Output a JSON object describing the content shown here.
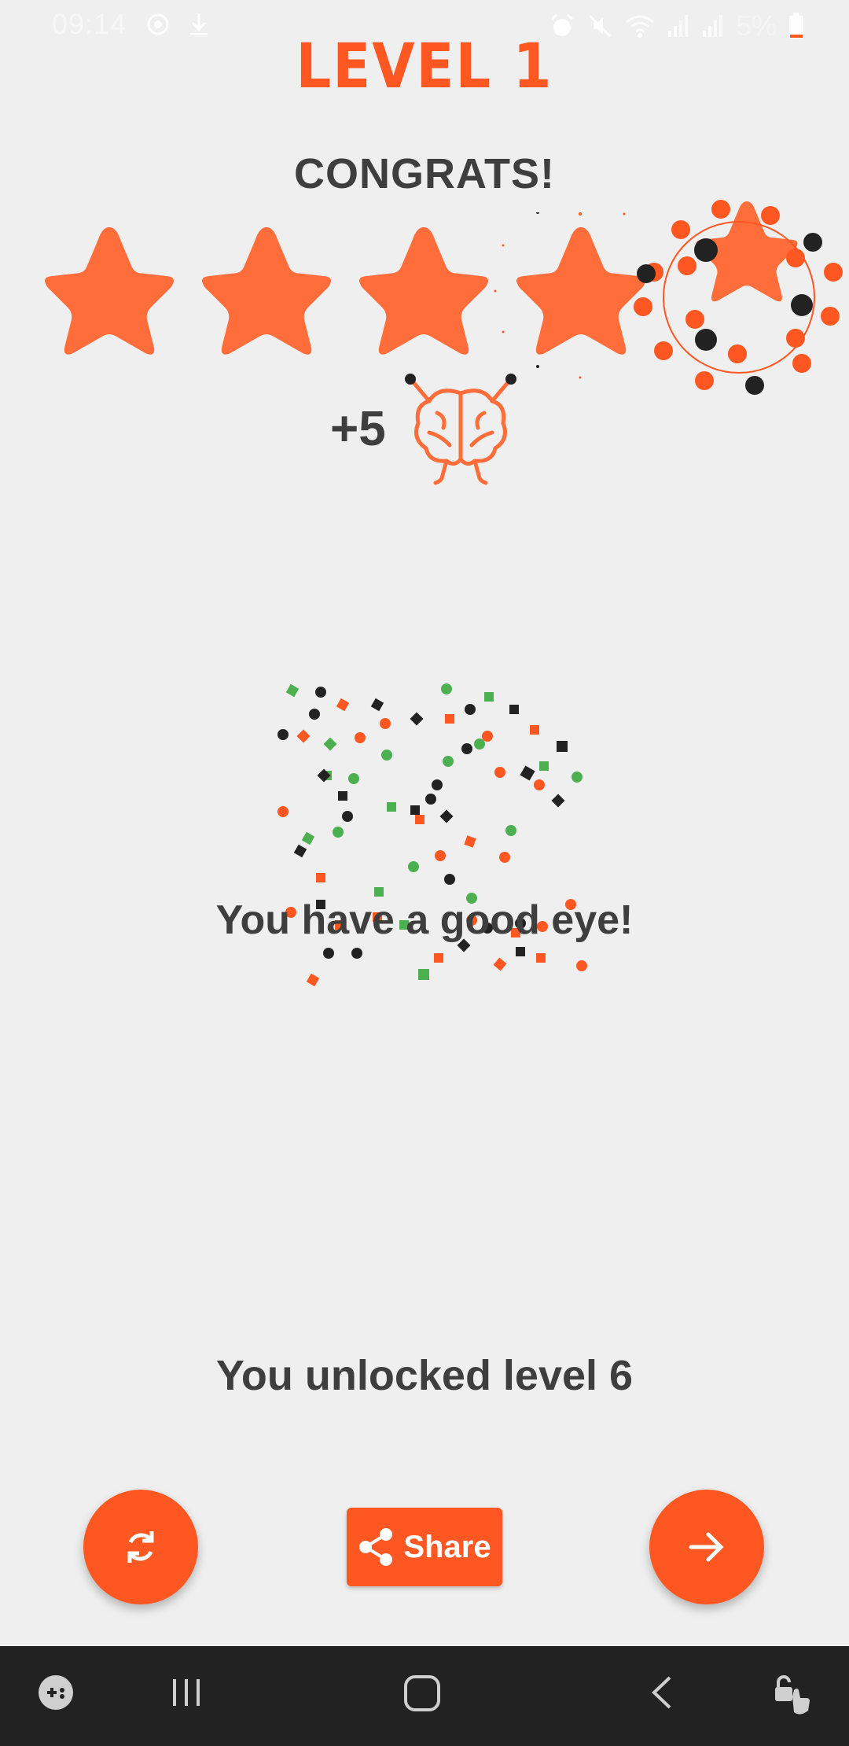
{
  "status_bar": {
    "time": "09:14",
    "battery": "5%",
    "icons": [
      "sync-icon",
      "download-icon",
      "alarm-icon",
      "mute-icon",
      "wifi-icon",
      "signal-icon",
      "signal-icon",
      "battery-icon"
    ]
  },
  "header": {
    "title": "LEVEL 1",
    "subtitle": "CONGRATS!"
  },
  "rating": {
    "stars_earned": 5,
    "stars_total": 5
  },
  "reward": {
    "points": "+5",
    "icon": "brain-icon"
  },
  "message": "You have a good eye!",
  "unlock_text": "You unlocked level 6",
  "actions": {
    "share_label": "Share",
    "restart_icon": "refresh-icon",
    "next_icon": "arrow-right-icon"
  },
  "nav_bar": {
    "icons": [
      "game-launcher-icon",
      "recents-icon",
      "home-icon",
      "back-icon",
      "lock-touch-icon"
    ]
  },
  "colors": {
    "accent": "#ff5722",
    "star": "#ff6d3a",
    "text": "#3e3e3e",
    "background": "#efefef",
    "nav": "#222222"
  }
}
